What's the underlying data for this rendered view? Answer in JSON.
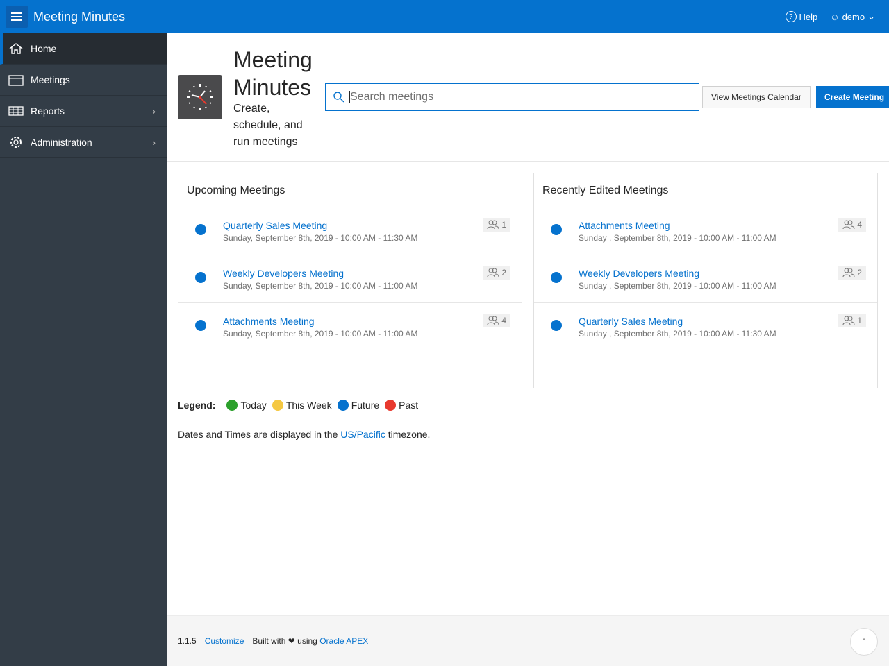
{
  "header": {
    "app_title": "Meeting Minutes",
    "help": "Help",
    "user": "demo"
  },
  "sidebar": {
    "items": [
      {
        "label": "Home",
        "icon": "home-icon"
      },
      {
        "label": "Meetings",
        "icon": "calendar-icon"
      },
      {
        "label": "Reports",
        "icon": "table-icon"
      },
      {
        "label": "Administration",
        "icon": "gear-icon"
      }
    ]
  },
  "hero": {
    "title": "Meeting Minutes",
    "subtitle": "Create, schedule, and run meetings",
    "search_placeholder": "Search meetings",
    "calendar_button": "View Meetings Calendar",
    "create_button": "Create Meeting"
  },
  "upcoming": {
    "title": "Upcoming Meetings",
    "items": [
      {
        "title": "Quarterly Sales Meeting",
        "date": "Sunday, September 8th, 2019 - 10:00 AM - 11:30 AM",
        "count": "1"
      },
      {
        "title": "Weekly Developers Meeting",
        "date": "Sunday, September 8th, 2019 - 10:00 AM - 11:00 AM",
        "count": "2"
      },
      {
        "title": "Attachments Meeting",
        "date": "Sunday, September 8th, 2019 - 10:00 AM - 11:00 AM",
        "count": "4"
      }
    ]
  },
  "recent": {
    "title": "Recently Edited Meetings",
    "items": [
      {
        "title": "Attachments Meeting",
        "date": "Sunday , September 8th, 2019 - 10:00 AM - 11:00 AM",
        "count": "4"
      },
      {
        "title": "Weekly Developers Meeting",
        "date": "Sunday , September 8th, 2019 - 10:00 AM - 11:00 AM",
        "count": "2"
      },
      {
        "title": "Quarterly Sales Meeting",
        "date": "Sunday , September 8th, 2019 - 10:00 AM - 11:30 AM",
        "count": "1"
      }
    ]
  },
  "legend": {
    "label": "Legend:",
    "items": [
      {
        "label": "Today",
        "color": "#2ca02c"
      },
      {
        "label": "This Week",
        "color": "#f5c842"
      },
      {
        "label": "Future",
        "color": "#0572ce"
      },
      {
        "label": "Past",
        "color": "#e8392e"
      }
    ]
  },
  "timezone": {
    "prefix": "Dates and Times are displayed in the",
    "link": "US/Pacific",
    "suffix": "timezone."
  },
  "footer": {
    "version": "1.1.5",
    "customize": "Customize",
    "built": "Built with",
    "using": "using",
    "apex": "Oracle APEX"
  }
}
